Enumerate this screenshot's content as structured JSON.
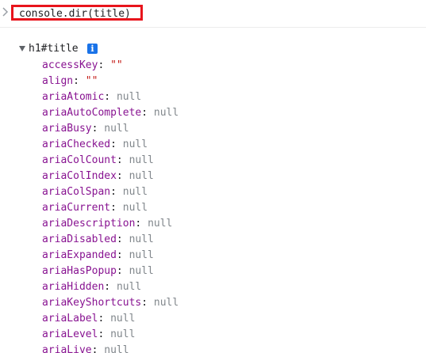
{
  "console": {
    "command": "console.dir(title)"
  },
  "object": {
    "label": "h1#title",
    "info_badge": "i",
    "properties": [
      {
        "key": "accessKey",
        "value": "\"\"",
        "kind": "string"
      },
      {
        "key": "align",
        "value": "\"\"",
        "kind": "string"
      },
      {
        "key": "ariaAtomic",
        "value": "null",
        "kind": "null"
      },
      {
        "key": "ariaAutoComplete",
        "value": "null",
        "kind": "null"
      },
      {
        "key": "ariaBusy",
        "value": "null",
        "kind": "null"
      },
      {
        "key": "ariaChecked",
        "value": "null",
        "kind": "null"
      },
      {
        "key": "ariaColCount",
        "value": "null",
        "kind": "null"
      },
      {
        "key": "ariaColIndex",
        "value": "null",
        "kind": "null"
      },
      {
        "key": "ariaColSpan",
        "value": "null",
        "kind": "null"
      },
      {
        "key": "ariaCurrent",
        "value": "null",
        "kind": "null"
      },
      {
        "key": "ariaDescription",
        "value": "null",
        "kind": "null"
      },
      {
        "key": "ariaDisabled",
        "value": "null",
        "kind": "null"
      },
      {
        "key": "ariaExpanded",
        "value": "null",
        "kind": "null"
      },
      {
        "key": "ariaHasPopup",
        "value": "null",
        "kind": "null"
      },
      {
        "key": "ariaHidden",
        "value": "null",
        "kind": "null"
      },
      {
        "key": "ariaKeyShortcuts",
        "value": "null",
        "kind": "null"
      },
      {
        "key": "ariaLabel",
        "value": "null",
        "kind": "null"
      },
      {
        "key": "ariaLevel",
        "value": "null",
        "kind": "null"
      },
      {
        "key": "ariaLive",
        "value": "null",
        "kind": "null"
      }
    ]
  },
  "colors": {
    "highlight_border": "#e8141c",
    "property_key": "#881391",
    "string_value": "#c41a16",
    "null_value": "#80868b",
    "info_badge": "#1a73e8"
  },
  "icons": {
    "prompt": "chevron-right-icon",
    "expand": "triangle-down-icon",
    "info": "info-icon"
  }
}
